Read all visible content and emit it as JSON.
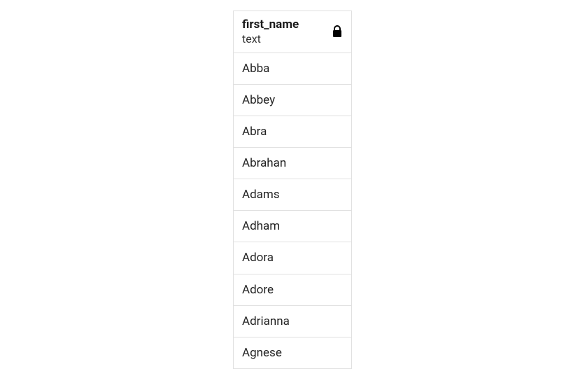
{
  "column": {
    "name": "first_name",
    "type": "text",
    "locked": true,
    "rows": [
      "Abba",
      "Abbey",
      "Abra",
      "Abrahan",
      "Adams",
      "Adham",
      "Adora",
      "Adore",
      "Adrianna",
      "Agnese"
    ]
  }
}
